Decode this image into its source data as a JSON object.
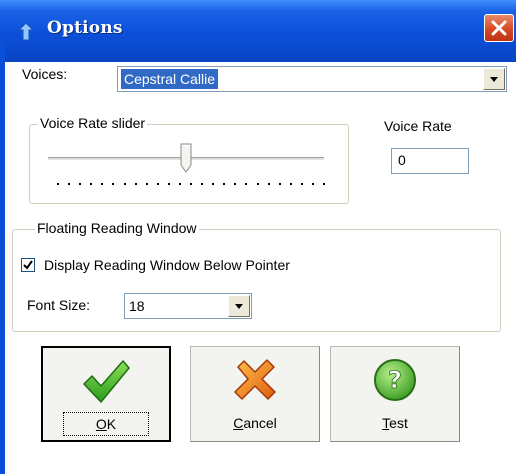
{
  "window": {
    "title": "Options"
  },
  "voices": {
    "label": "Voices:",
    "selected": "Cepstral Callie"
  },
  "voice_rate_slider": {
    "group_label": "Voice Rate slider",
    "position": 0.5
  },
  "voice_rate": {
    "label": "Voice Rate",
    "value": "0"
  },
  "floating_window": {
    "group_label": "Floating Reading Window",
    "display_below_pointer_label": "Display Reading Window Below Pointer",
    "display_below_pointer_checked": true,
    "font_size_label": "Font Size:",
    "font_size_value": "18"
  },
  "buttons": {
    "ok": {
      "mnemonic": "O",
      "rest": "K",
      "icon": "checkmark-icon"
    },
    "cancel": {
      "mnemonic": "C",
      "rest": "ancel",
      "icon": "cross-icon"
    },
    "test": {
      "mnemonic": "T",
      "rest": "est",
      "icon": "question-icon"
    }
  },
  "colors": {
    "titlebar": "#0b4fd9",
    "selection": "#316ac5",
    "close": "#d4451e"
  }
}
